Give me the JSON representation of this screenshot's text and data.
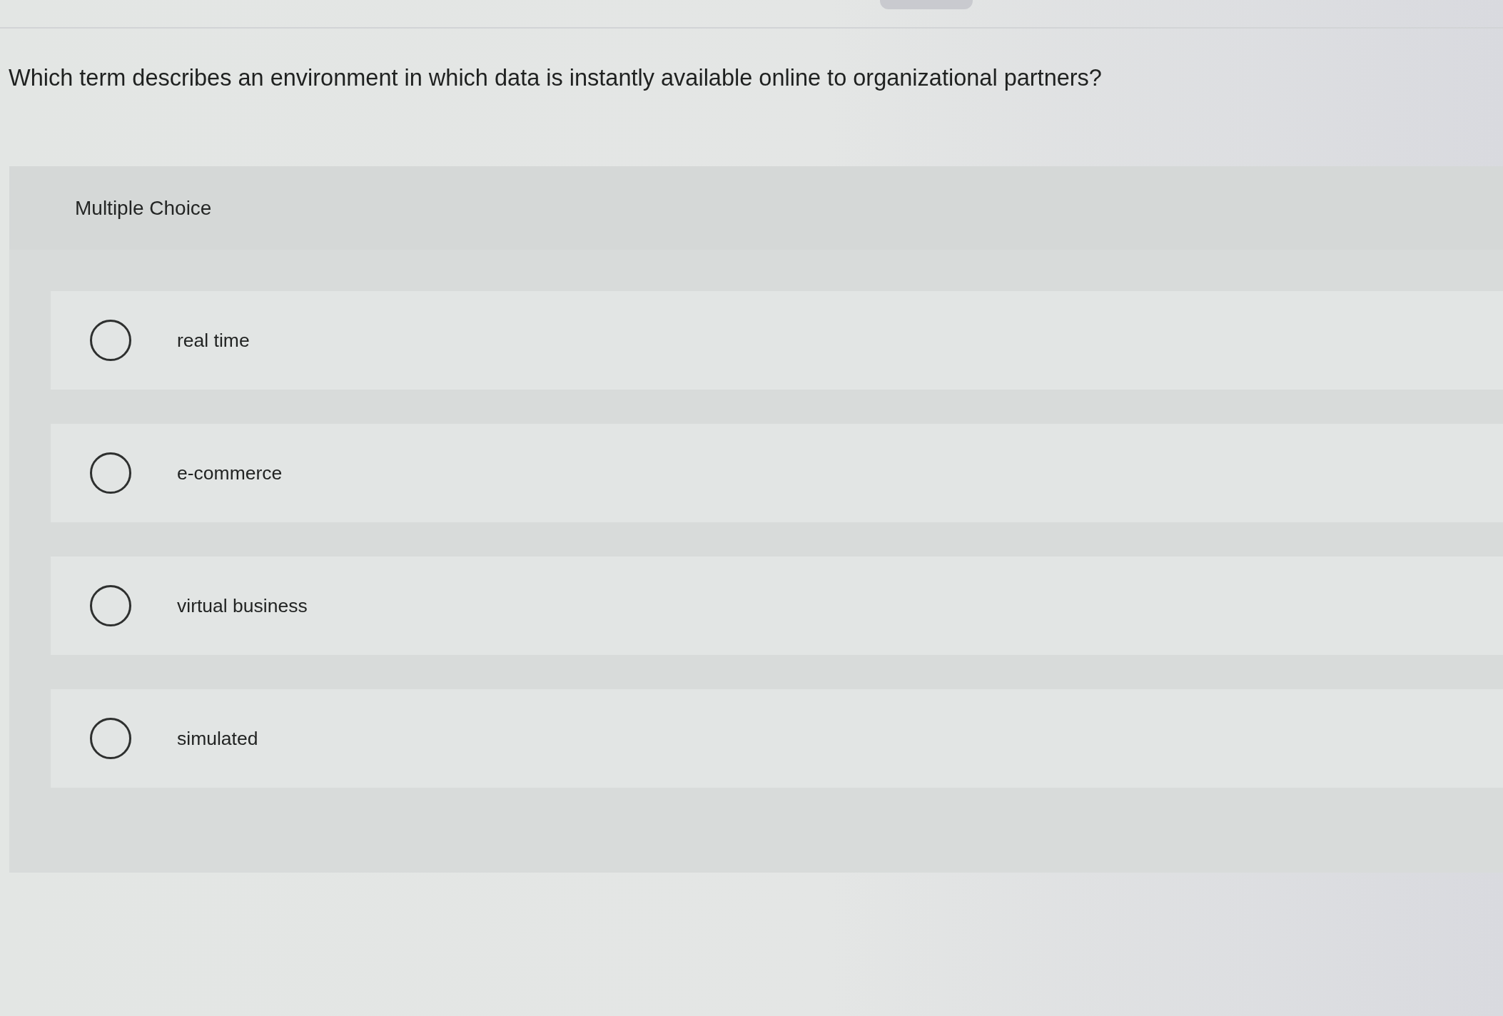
{
  "question": "Which term describes an environment in which data is instantly available online to organizational partners?",
  "panel": {
    "label": "Multiple Choice",
    "options": [
      {
        "label": "real time",
        "selected": false
      },
      {
        "label": "e-commerce",
        "selected": false
      },
      {
        "label": "virtual business",
        "selected": false
      },
      {
        "label": "simulated",
        "selected": false
      }
    ]
  }
}
